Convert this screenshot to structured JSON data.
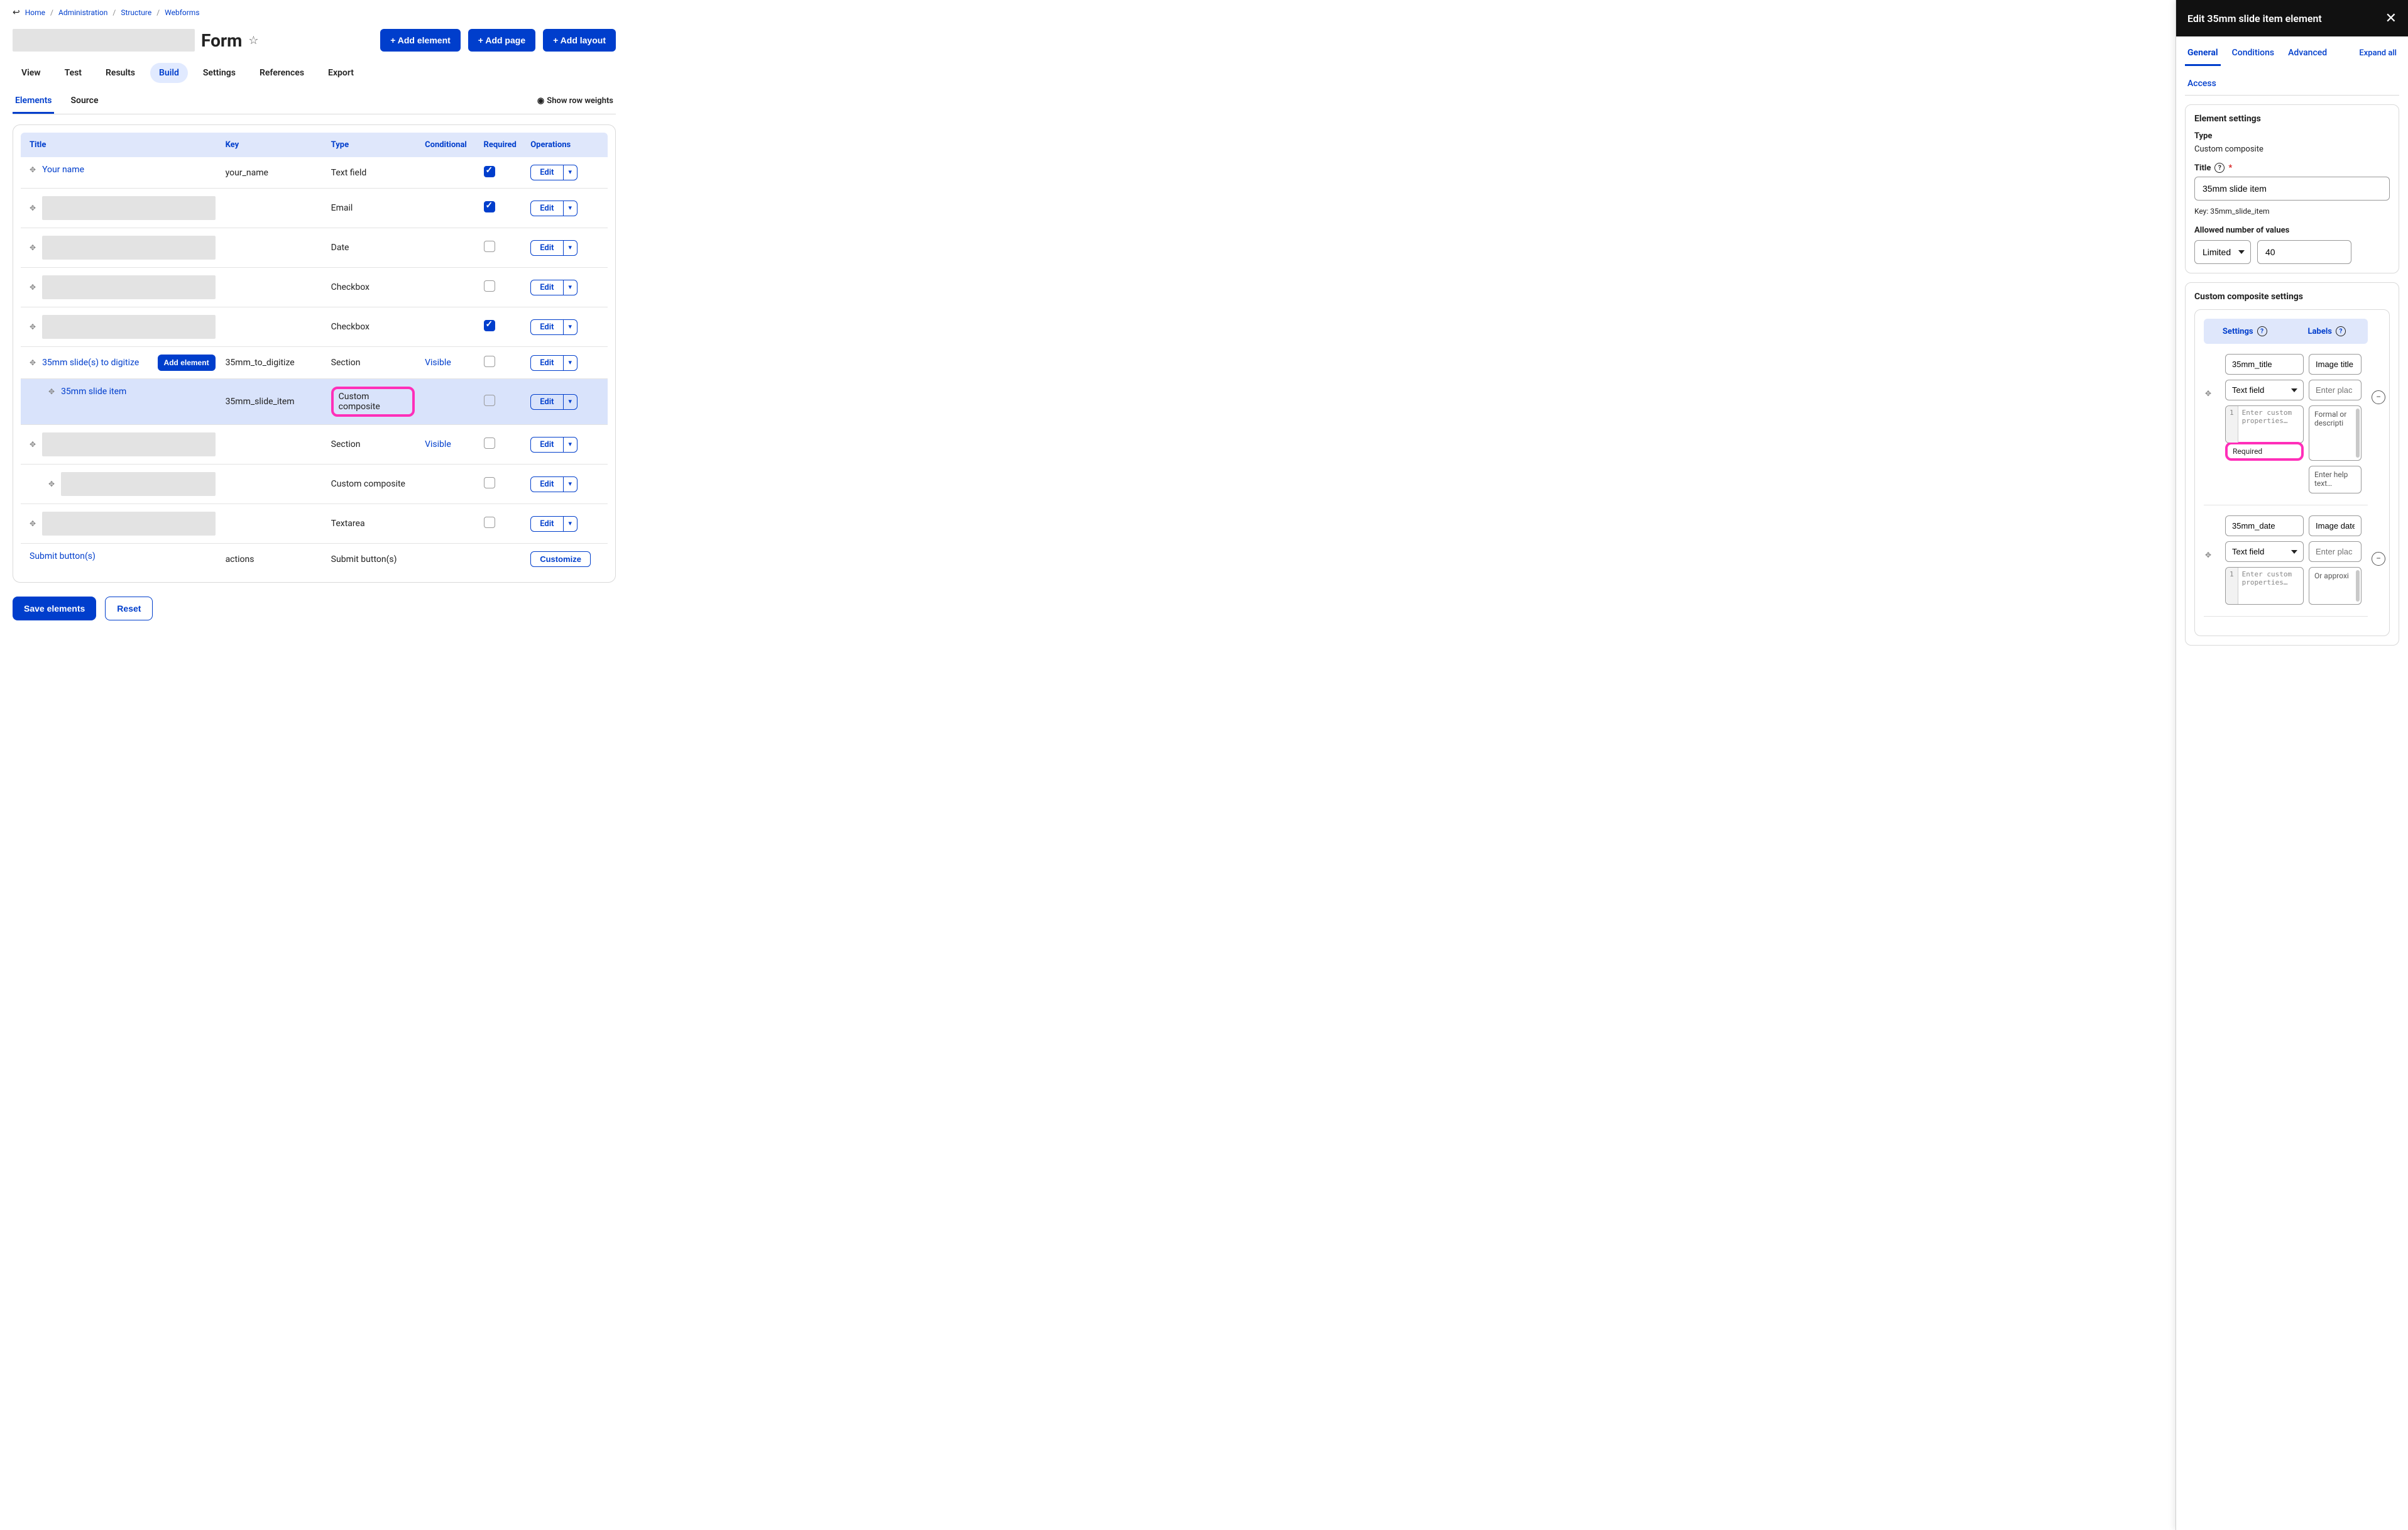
{
  "breadcrumbs": {
    "items": [
      "Home",
      "Administration",
      "Structure",
      "Webforms"
    ]
  },
  "page": {
    "title_suffix": "Form"
  },
  "header_buttons": {
    "add_element": "+ Add element",
    "add_page": "+ Add page",
    "add_layout": "+ Add layout"
  },
  "primary_tabs": [
    "View",
    "Test",
    "Results",
    "Build",
    "Settings",
    "References",
    "Export"
  ],
  "primary_active": "Build",
  "secondary_tabs": [
    "Elements",
    "Source"
  ],
  "secondary_active": "Elements",
  "show_row_weights": "Show row weights",
  "table": {
    "headers": {
      "title": "Title",
      "key": "Key",
      "type": "Type",
      "conditional": "Conditional",
      "required": "Required",
      "operations": "Operations"
    },
    "edit_label": "Edit",
    "customize_label": "Customize",
    "add_element_inline": "Add element",
    "rows": [
      {
        "title": "Your name",
        "key": "your_name",
        "type": "Text field",
        "conditional": "",
        "required": true,
        "redacted": false,
        "indent": 0
      },
      {
        "title": "",
        "key": "",
        "type": "Email",
        "conditional": "",
        "required": true,
        "redacted": true,
        "indent": 0
      },
      {
        "title": "",
        "key": "",
        "type": "Date",
        "conditional": "",
        "required": false,
        "redacted": true,
        "indent": 0
      },
      {
        "title": "",
        "key": "",
        "type": "Checkbox",
        "conditional": "",
        "required": false,
        "redacted": true,
        "indent": 0
      },
      {
        "title": "",
        "key": "",
        "type": "Checkbox",
        "conditional": "",
        "required": true,
        "redacted": true,
        "indent": 0
      },
      {
        "title": "35mm slide(s) to digitize",
        "key": "35mm_to_digitize",
        "type": "Section",
        "conditional": "Visible",
        "required": false,
        "redacted": false,
        "indent": 0,
        "add_button": true
      },
      {
        "title": "35mm slide item",
        "key": "35mm_slide_item",
        "type": "Custom composite",
        "conditional": "",
        "required": false,
        "redacted": false,
        "indent": 1,
        "selected": true,
        "type_highlighted": true
      },
      {
        "title": "",
        "key": "",
        "type": "Section",
        "conditional": "Visible",
        "required": false,
        "redacted": true,
        "indent": 0
      },
      {
        "title": "",
        "key": "",
        "type": "Custom composite",
        "conditional": "",
        "required": false,
        "redacted": true,
        "indent": 1
      },
      {
        "title": "",
        "key": "",
        "type": "Textarea",
        "conditional": "",
        "required": false,
        "redacted": true,
        "indent": 0
      }
    ],
    "footer": {
      "title": "Submit button(s)",
      "key": "actions",
      "type": "Submit button(s)"
    }
  },
  "actions": {
    "save": "Save elements",
    "reset": "Reset"
  },
  "panel": {
    "title": "Edit 35mm slide item element",
    "tabs": [
      "General",
      "Conditions",
      "Advanced",
      "Access"
    ],
    "active": "General",
    "expand_all": "Expand all",
    "element_settings": {
      "heading": "Element settings",
      "type_label": "Type",
      "type_value": "Custom composite",
      "title_label": "Title",
      "title_value": "35mm slide item",
      "key_label": "Key: 35mm_slide_item",
      "allowed_label": "Allowed number of values",
      "allowed_mode": "Limited",
      "allowed_count": "40"
    },
    "composite": {
      "heading": "Custom composite settings",
      "tab_settings": "Settings",
      "tab_labels": "Labels",
      "code_placeholder": "Enter custom properties…",
      "required_label": "Required",
      "help_placeholder": "Enter help text…",
      "fields": [
        {
          "key": "35mm_title",
          "label": "Image title",
          "type": "Text field",
          "enter_placeholder": "Enter plac",
          "desc": "Formal or descripti"
        },
        {
          "key": "35mm_date",
          "label": "Image date",
          "type": "Text field",
          "enter_placeholder": "Enter plac",
          "desc": "Or approxi"
        }
      ]
    }
  }
}
